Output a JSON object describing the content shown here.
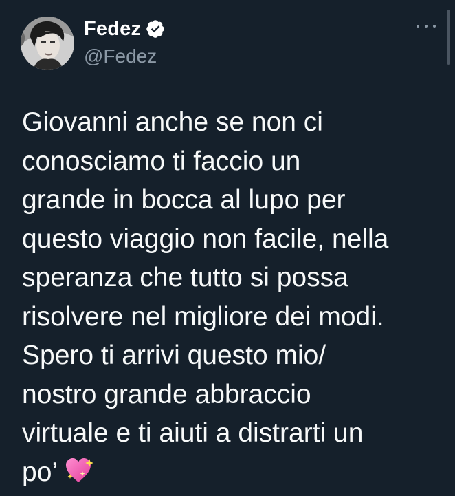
{
  "tweet": {
    "author": {
      "display_name": "Fedez",
      "handle": "@Fedez",
      "verified": true
    },
    "text": "Giovanni anche se non ci\nconosciamo ti faccio un\ngrande in bocca al lupo per\nquesto viaggio non facile, nella\nsperanza che tutto si possa\nrisolvere nel migliore dei modi.\nSpero ti arrivi questo mio/\nnostro grande abbraccio\nvirtuale e ti aiuti a distrarti un\npo’",
    "emoji": "sparkling-heart-icon"
  },
  "colors": {
    "background": "#15202b",
    "text": "#f7f9f9",
    "secondary": "#8b98a5",
    "verified": "#ffffff"
  }
}
